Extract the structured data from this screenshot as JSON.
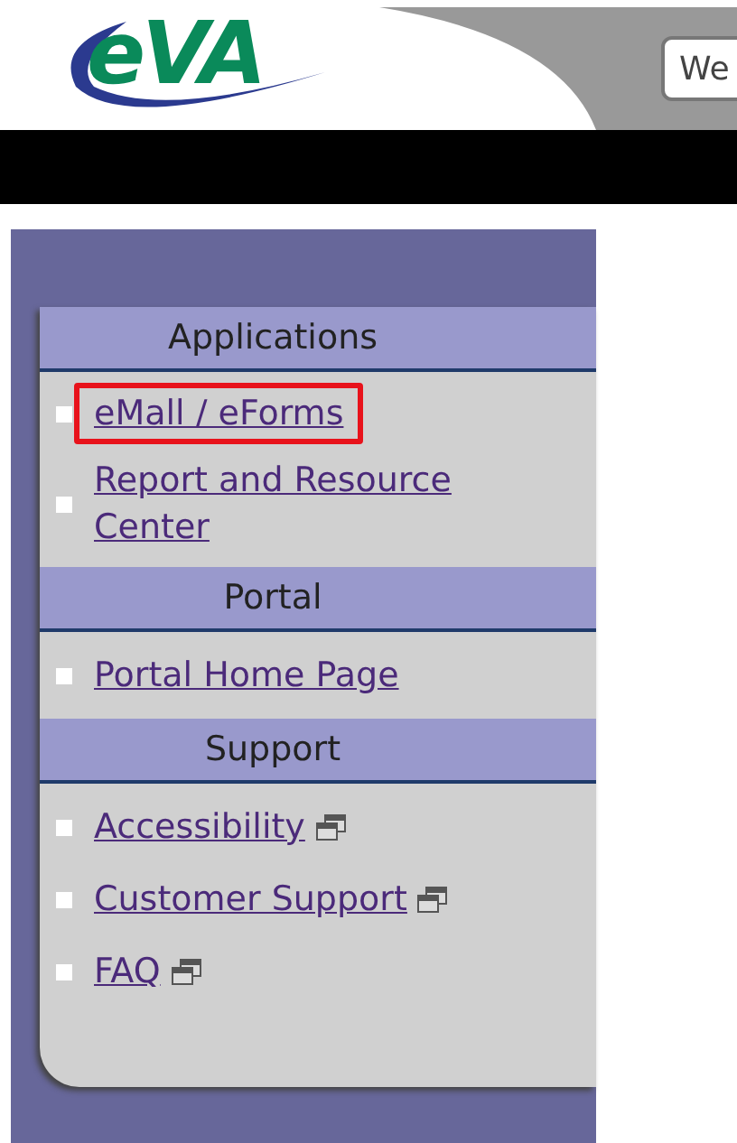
{
  "header": {
    "logo": "eVA",
    "search": {
      "value": "We"
    }
  },
  "sidebar": {
    "sections": [
      {
        "title": "Applications",
        "items": [
          {
            "label": "eMall / eForms",
            "highlighted": true,
            "new_window": false
          },
          {
            "label": "Report and Resource Center",
            "highlighted": false,
            "new_window": false
          }
        ]
      },
      {
        "title": "Portal",
        "items": [
          {
            "label": "Portal Home Page",
            "highlighted": false,
            "new_window": false
          }
        ]
      },
      {
        "title": "Support",
        "items": [
          {
            "label": "Accessibility",
            "highlighted": false,
            "new_window": true
          },
          {
            "label": "Customer Support",
            "highlighted": false,
            "new_window": true
          },
          {
            "label": "FAQ",
            "highlighted": false,
            "new_window": true
          }
        ]
      }
    ]
  }
}
